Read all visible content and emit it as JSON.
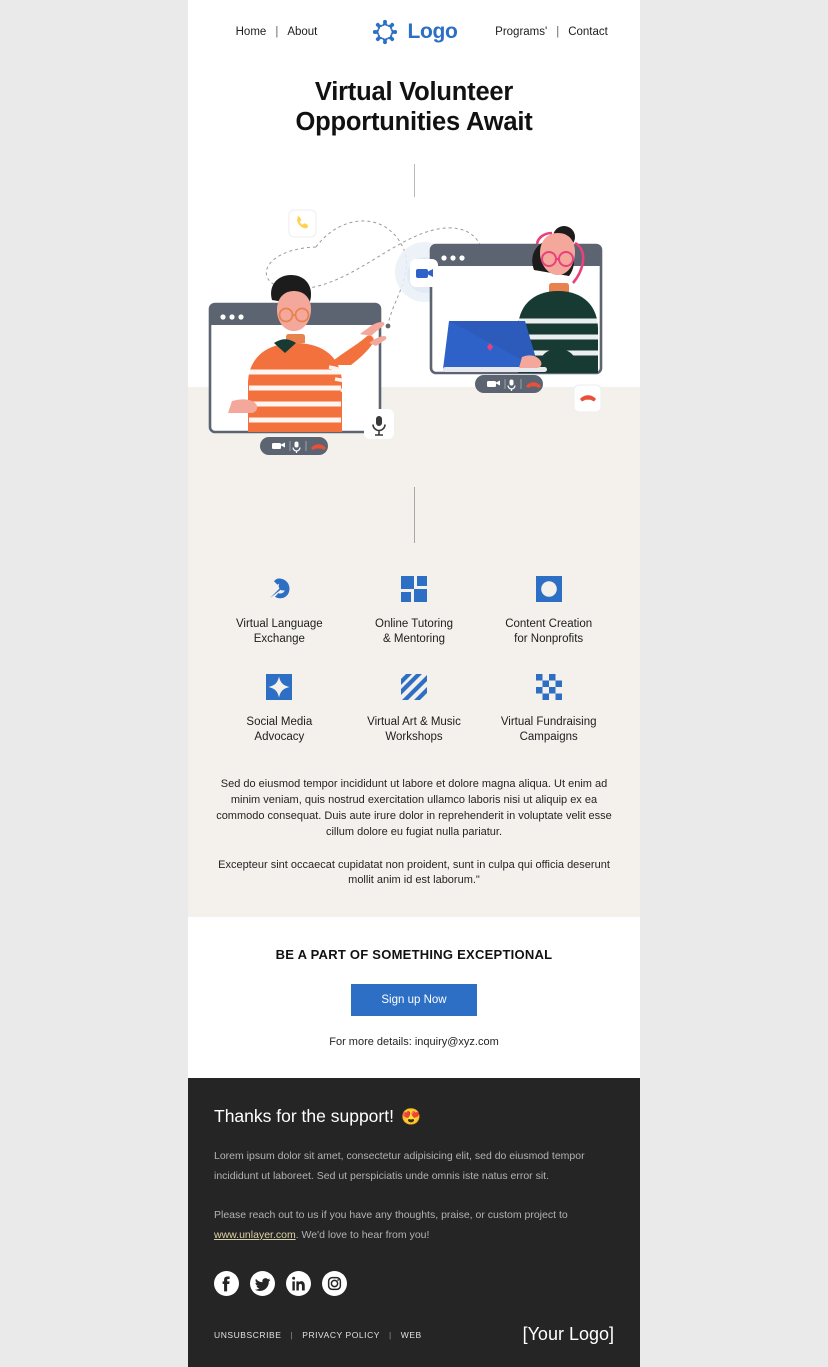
{
  "nav": {
    "left": [
      {
        "label": "Home",
        "name": "nav-link-home"
      },
      {
        "label": "About",
        "name": "nav-link-about"
      }
    ],
    "right": [
      {
        "label": "Programs'",
        "name": "nav-link-programs"
      },
      {
        "label": "Contact",
        "name": "nav-link-contact"
      }
    ],
    "separator": "|",
    "brand": "Logo"
  },
  "hero": {
    "title_line1": "Virtual Volunteer",
    "title_line2": "Opportunities Await"
  },
  "features": [
    {
      "label_line1": "Virtual Language",
      "label_line2": "Exchange",
      "icon": "arrow-pin-icon"
    },
    {
      "label_line1": "Online Tutoring",
      "label_line2": "& Mentoring",
      "icon": "grid-squares-icon"
    },
    {
      "label_line1": "Content Creation",
      "label_line2": "for Nonprofits",
      "icon": "square-circle-icon"
    },
    {
      "label_line1": "Social Media",
      "label_line2": "Advocacy",
      "icon": "sparkle-square-icon"
    },
    {
      "label_line1": "Virtual Art & Music",
      "label_line2": "Workshops",
      "icon": "diagonal-stripes-icon"
    },
    {
      "label_line1": "Virtual Fundraising",
      "label_line2": "Campaigns",
      "icon": "checkerboard-icon"
    }
  ],
  "body": {
    "paragraph1": "Sed do eiusmod tempor incididunt ut labore et dolore magna aliqua. Ut enim ad minim veniam, quis nostrud exercitation ullamco laboris nisi ut aliquip ex ea commodo consequat. Duis aute irure dolor in reprehenderit in voluptate velit esse cillum dolore eu fugiat nulla pariatur.",
    "paragraph2": "Excepteur sint occaecat cupidatat non proident, sunt in culpa qui officia deserunt mollit anim id est laborum.\""
  },
  "cta": {
    "title": "BE A PART OF SOMETHING EXCEPTIONAL",
    "button_label": "Sign up Now",
    "note": "For more details: inquiry@xyz.com"
  },
  "footer": {
    "title": "Thanks for the support!",
    "emoji": "😍",
    "paragraph1": "Lorem ipsum dolor sit amet, consectetur adipisicing elit, sed do eiusmod tempor incididunt ut laboreet. Sed ut perspiciatis unde omnis iste natus error sit.",
    "paragraph2_before": "Please reach out to us if you have any thoughts, praise, or custom project to ",
    "paragraph2_link": "www.unlayer.com",
    "paragraph2_after": ". We'd love to hear from you!",
    "socials": [
      {
        "name": "facebook-icon",
        "label": "Facebook"
      },
      {
        "name": "twitter-icon",
        "label": "Twitter"
      },
      {
        "name": "linkedin-icon",
        "label": "LinkedIn"
      },
      {
        "name": "instagram-icon",
        "label": "Instagram"
      }
    ],
    "links": [
      {
        "label": "UNSUBSCRIBE",
        "name": "footer-link-unsubscribe"
      },
      {
        "label": "PRIVACY POLICY",
        "name": "footer-link-privacy"
      },
      {
        "label": "WEB",
        "name": "footer-link-web"
      }
    ],
    "separator": "|",
    "logo_text": "[Your Logo]"
  },
  "colors": {
    "brand_blue": "#2c6fc4",
    "cream": "#f4f1ec",
    "footer_dark": "#252525",
    "link_gold": "#dcd2a8"
  }
}
